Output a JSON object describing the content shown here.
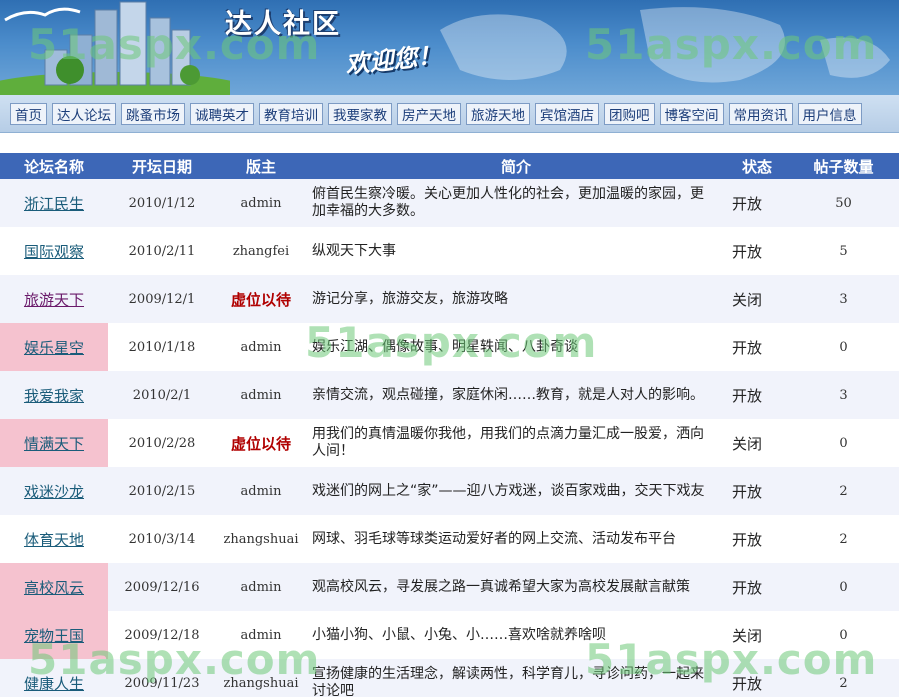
{
  "banner": {
    "title": "达人社区",
    "welcome": "欢迎您！",
    "watermark": "51aspx.com"
  },
  "nav": [
    "首页",
    "达人论坛",
    "跳蚤市场",
    "诚聘英才",
    "教育培训",
    "我要家教",
    "房产天地",
    "旅游天地",
    "宾馆酒店",
    "团购吧",
    "博客空间",
    "常用资讯",
    "用户信息"
  ],
  "table": {
    "headers": {
      "name": "论坛名称",
      "date": "开坛日期",
      "moderator": "版主",
      "intro": "简介",
      "status": "状态",
      "posts": "帖子数量"
    },
    "rows": [
      {
        "name": "浙江民生",
        "date": "2010/1/12",
        "moderator": "admin",
        "intro": "俯首民生察冷暖。关心更加人性化的社会，更加温暖的家园，更加幸福的大多数。",
        "status": "开放",
        "posts": "50"
      },
      {
        "name": "国际观察",
        "date": "2010/2/11",
        "moderator": "zhangfei",
        "intro": "纵观天下大事",
        "status": "开放",
        "posts": "5"
      },
      {
        "name": "旅游天下",
        "date": "2009/12/1",
        "moderator": "虚位以待",
        "intro": "游记分享，旅游交友，旅游攻略",
        "status": "关闭",
        "posts": "3"
      },
      {
        "name": "娱乐星空",
        "date": "2010/1/18",
        "moderator": "admin",
        "intro": "娱乐江湖、偶像故事、明星轶闻、八卦奇谈",
        "status": "开放",
        "posts": "0"
      },
      {
        "name": "我爱我家",
        "date": "2010/2/1",
        "moderator": "admin",
        "intro": "亲情交流，观点碰撞，家庭休闲……教育，就是人对人的影响。",
        "status": "开放",
        "posts": "3"
      },
      {
        "name": "情满天下",
        "date": "2010/2/28",
        "moderator": "虚位以待",
        "intro": "用我们的真情温暖你我他，用我们的点滴力量汇成一股爱，洒向人间！",
        "status": "关闭",
        "posts": "0"
      },
      {
        "name": "戏迷沙龙",
        "date": "2010/2/15",
        "moderator": "admin",
        "intro": "戏迷们的网上之“家”——迎八方戏迷，谈百家戏曲，交天下戏友",
        "status": "开放",
        "posts": "2"
      },
      {
        "name": "体育天地",
        "date": "2010/3/14",
        "moderator": "zhangshuai",
        "intro": "网球、羽毛球等球类运动爱好者的网上交流、活动发布平台",
        "status": "开放",
        "posts": "2"
      },
      {
        "name": "高校风云",
        "date": "2009/12/16",
        "moderator": "admin",
        "intro": "观高校风云，寻发展之路一真诚希望大家为高校发展献言献策",
        "status": "开放",
        "posts": "0"
      },
      {
        "name": "宠物王国",
        "date": "2009/12/18",
        "moderator": "admin",
        "intro": "小猫小狗、小鼠、小兔、小……喜欢啥就养啥呗",
        "status": "关闭",
        "posts": "0"
      },
      {
        "name": "健康人生",
        "date": "2009/11/23",
        "moderator": "zhangshuai",
        "intro": "宣扬健康的生活理念，解读两性，科学育儿，寻诊问药，一起来讨论吧",
        "status": "开放",
        "posts": "2"
      }
    ]
  },
  "colors": {
    "header_bg": "#3d67b7",
    "vacant_moderator": "#b00000",
    "highlight_pink": "#f5c2cf"
  }
}
